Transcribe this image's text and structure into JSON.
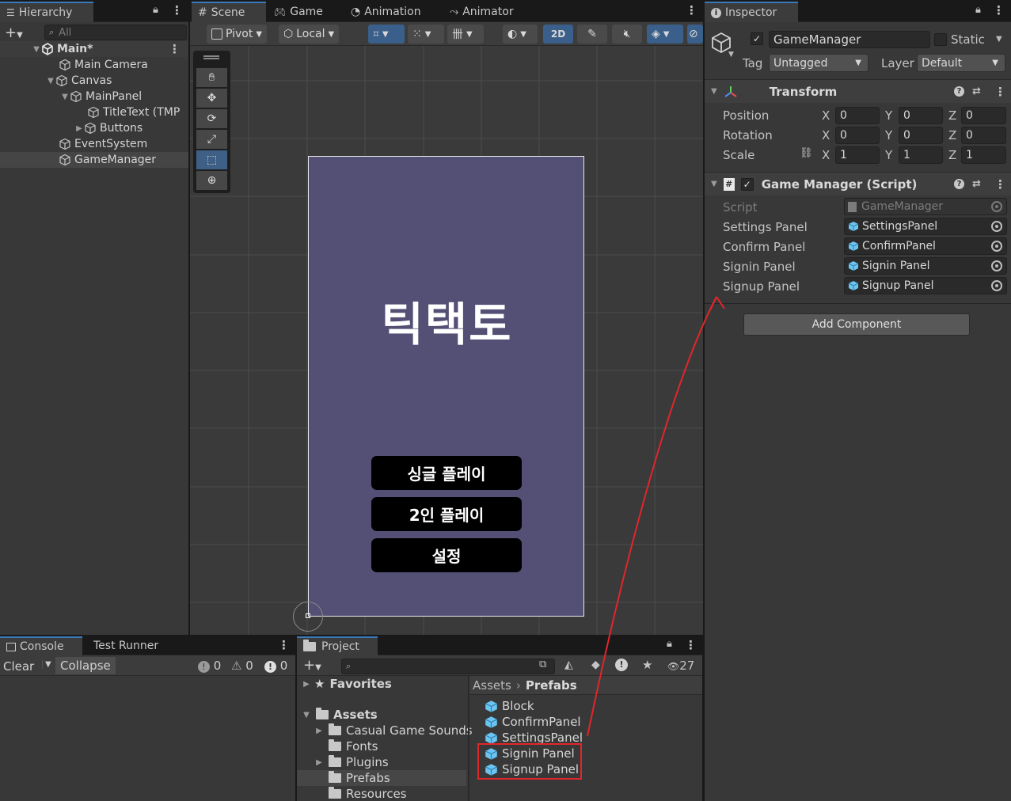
{
  "hierarchy": {
    "tab": "Hierarchy",
    "search_placeholder": "All",
    "scene": "Main*",
    "items": [
      "Main Camera",
      "Canvas",
      "MainPanel",
      "TitleText (TMP",
      "Buttons",
      "EventSystem",
      "GameManager"
    ]
  },
  "scene_view": {
    "tabs": [
      "Scene",
      "Game",
      "Animation",
      "Animator"
    ],
    "pivot": "Pivot",
    "local": "Local",
    "mode_2d": "2D",
    "title": "틱택토",
    "buttons": [
      "싱글 플레이",
      "2인 플레이",
      "설정"
    ]
  },
  "inspector": {
    "tab": "Inspector",
    "object_name": "GameManager",
    "static_label": "Static",
    "tag_label": "Tag",
    "tag_value": "Untagged",
    "layer_label": "Layer",
    "layer_value": "Default",
    "transform": {
      "title": "Transform",
      "rows": [
        {
          "label": "Position",
          "x": "0",
          "y": "0",
          "z": "0"
        },
        {
          "label": "Rotation",
          "x": "0",
          "y": "0",
          "z": "0"
        },
        {
          "label": "Scale",
          "x": "1",
          "y": "1",
          "z": "1"
        }
      ],
      "axis": [
        "X",
        "Y",
        "Z"
      ]
    },
    "script_component": {
      "title": "Game Manager (Script)",
      "fields": [
        {
          "label": "Script",
          "value": "GameManager"
        },
        {
          "label": "Settings Panel",
          "value": "SettingsPanel"
        },
        {
          "label": "Confirm Panel",
          "value": "ConfirmPanel"
        },
        {
          "label": "Signin Panel",
          "value": "Signin Panel"
        },
        {
          "label": "Signup Panel",
          "value": "Signup Panel"
        }
      ]
    },
    "add_component": "Add Component"
  },
  "console": {
    "tabs": [
      "Console",
      "Test Runner"
    ],
    "clear": "Clear",
    "collapse": "Collapse",
    "counts": [
      "0",
      "0",
      "0"
    ]
  },
  "project": {
    "tab": "Project",
    "hidden_count": "27",
    "favorites": "Favorites",
    "assets": "Assets",
    "folders": [
      "Casual Game Sounds",
      "Fonts",
      "Plugins",
      "Prefabs",
      "Resources"
    ],
    "breadcrumb_root": "Assets",
    "breadcrumb_leaf": "Prefabs",
    "prefabs": [
      "Block",
      "ConfirmPanel",
      "SettingsPanel",
      "Signin Panel",
      "Signup Panel"
    ]
  },
  "colors": {
    "accent": "#3a79bb",
    "panel_bg": "#383838",
    "scene_panel": "#534f75",
    "annotation": "#e0262b",
    "prefab_blue": "#6cc4f0"
  }
}
